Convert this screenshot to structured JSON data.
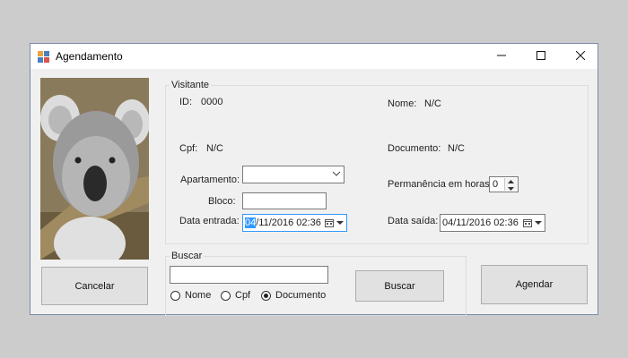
{
  "window": {
    "title": "Agendamento",
    "icons": {
      "app": "app-grid-icon",
      "minimize": "minimize-icon",
      "maximize": "maximize-icon",
      "close": "close-icon"
    }
  },
  "photo": {
    "subject": "koala-photo"
  },
  "visitante": {
    "legend": "Visitante",
    "id_label": "ID:",
    "id_value": "0000",
    "nome_label": "Nome:",
    "nome_value": "N/C",
    "cpf_label": "Cpf:",
    "cpf_value": "N/C",
    "documento_label": "Documento:",
    "documento_value": "N/C",
    "apartamento_label": "Apartamento:",
    "apartamento_value": "",
    "bloco_label": "Bloco:",
    "bloco_value": "",
    "permanencia_label": "Permanência em horas:",
    "permanencia_value": "0",
    "data_entrada_label": "Data entrada:",
    "data_entrada_selected": "04",
    "data_entrada_rest": "/11/2016 02:36",
    "data_saida_label": "Data saída:",
    "data_saida_value": "04/11/2016 02:36"
  },
  "buscar": {
    "legend": "Buscar",
    "input_value": "",
    "button_label": "Buscar",
    "options": [
      "Nome",
      "Cpf",
      "Documento"
    ],
    "selected": "Documento"
  },
  "actions": {
    "cancel_label": "Cancelar",
    "schedule_label": "Agendar"
  },
  "colors": {
    "selection": "#3399ff",
    "window_bg": "#f0f0f0",
    "border": "#7a8ca8"
  }
}
